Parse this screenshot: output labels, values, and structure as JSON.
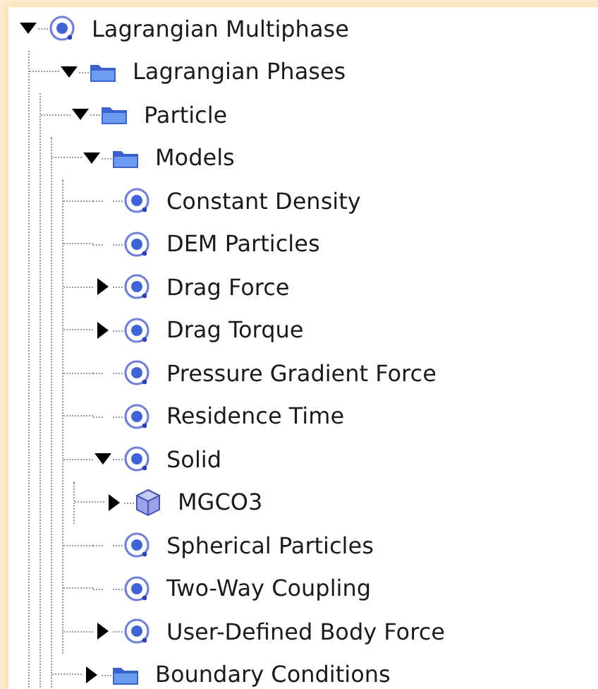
{
  "tree": [
    {
      "label": "Lagrangian Multiphase",
      "kind": "model",
      "expanded": true,
      "children": [
        {
          "label": "Lagrangian Phases",
          "kind": "folder",
          "expanded": true,
          "children": [
            {
              "label": "Particle",
              "kind": "folder",
              "expanded": true,
              "children": [
                {
                  "label": "Models",
                  "kind": "folder",
                  "expanded": true,
                  "children": [
                    {
                      "label": "Constant Density",
                      "kind": "model"
                    },
                    {
                      "label": "DEM Particles",
                      "kind": "model"
                    },
                    {
                      "label": "Drag Force",
                      "kind": "model",
                      "expanded": false
                    },
                    {
                      "label": "Drag Torque",
                      "kind": "model",
                      "expanded": false
                    },
                    {
                      "label": "Pressure Gradient Force",
                      "kind": "model"
                    },
                    {
                      "label": "Residence Time",
                      "kind": "model"
                    },
                    {
                      "label": "Solid",
                      "kind": "model",
                      "expanded": true,
                      "children": [
                        {
                          "label": "MGCO3",
                          "kind": "part",
                          "expanded": false
                        }
                      ]
                    },
                    {
                      "label": "Spherical Particles",
                      "kind": "model"
                    },
                    {
                      "label": "Two-Way Coupling",
                      "kind": "model"
                    },
                    {
                      "label": "User-Defined Body Force",
                      "kind": "model",
                      "expanded": false
                    }
                  ]
                },
                {
                  "label": "Boundary Conditions",
                  "kind": "folder",
                  "expanded": false
                }
              ]
            }
          ]
        }
      ]
    }
  ]
}
